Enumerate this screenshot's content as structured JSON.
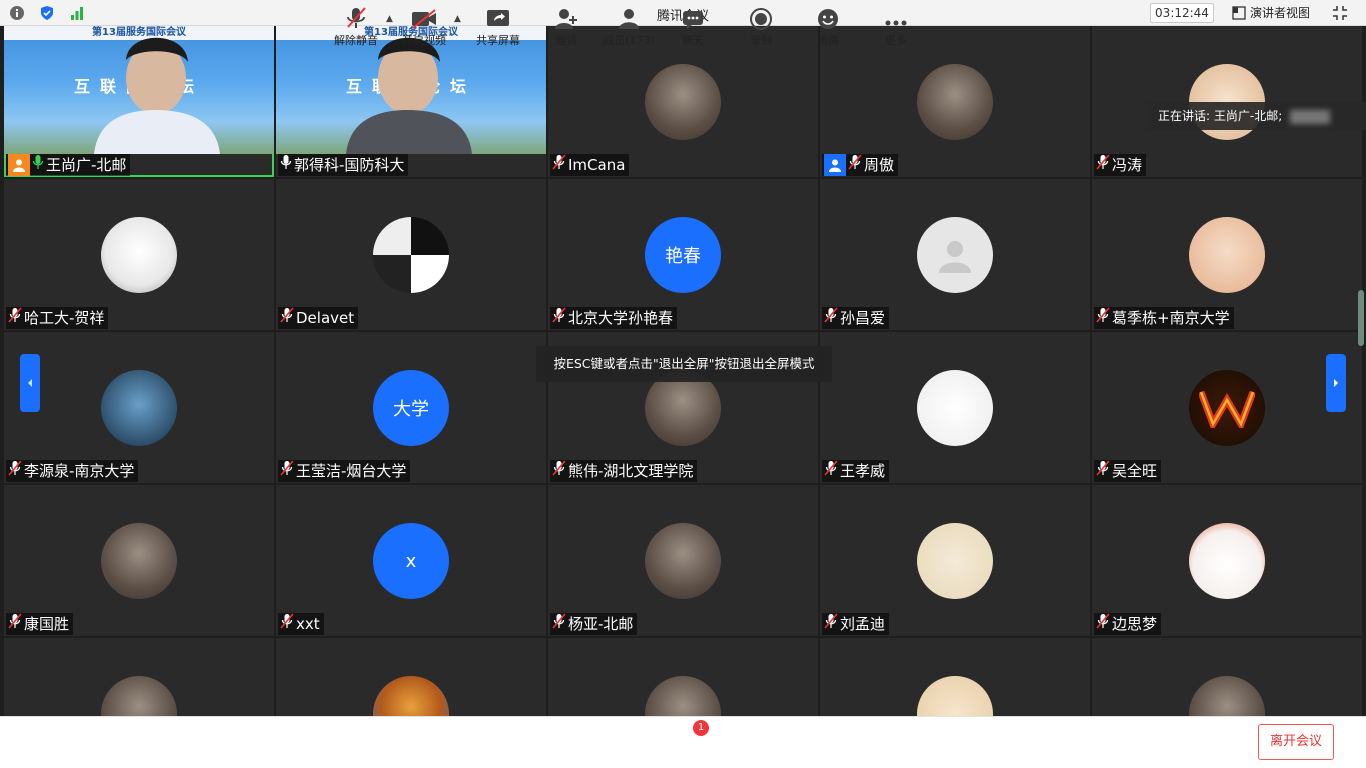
{
  "window": {
    "title": "腾讯会议",
    "timer": "03:12:44",
    "view_label": "演讲者视图"
  },
  "speaking": {
    "text": "正在讲话: 王尚广-北邮;"
  },
  "esc_tip": "按ESC键或者点击\"退出全屏\"按钮退出全屏模式",
  "video_banner": {
    "top": "第13届服务国际会议",
    "main": "互联网论坛"
  },
  "participants": [
    {
      "name": "王尚广-北邮",
      "mic": "on",
      "host": true,
      "video": true
    },
    {
      "name": "郭得科-国防科大",
      "mic": "on",
      "video": true
    },
    {
      "name": "ImCana",
      "mic": "muted",
      "avatar": "photo"
    },
    {
      "name": "周傲",
      "mic": "muted",
      "host": true,
      "avatar": "photo"
    },
    {
      "name": "冯涛",
      "mic": "muted",
      "avatar": "bear"
    },
    {
      "name": "哈工大-贺祥",
      "mic": "muted",
      "avatar": "anime"
    },
    {
      "name": "Delavet",
      "mic": "muted",
      "avatar": "crystal"
    },
    {
      "name": "北京大学孙艳春",
      "mic": "muted",
      "avatar_text": "艳春"
    },
    {
      "name": "孙昌爱",
      "mic": "muted",
      "avatar": "default"
    },
    {
      "name": "葛季栋+南京大学",
      "mic": "muted",
      "avatar": "baby"
    },
    {
      "name": "李源泉-南京大学",
      "mic": "muted",
      "avatar": "anime2"
    },
    {
      "name": "王莹洁-烟台大学",
      "mic": "muted",
      "avatar_text": "大学"
    },
    {
      "name": "熊伟-湖北文理学院",
      "mic": "muted",
      "avatar": "photo"
    },
    {
      "name": "王孝威",
      "mic": "muted",
      "avatar": "cat"
    },
    {
      "name": "吴全旺",
      "mic": "muted",
      "avatar": "w-logo"
    },
    {
      "name": "康国胜",
      "mic": "muted",
      "avatar": "photo"
    },
    {
      "name": "xxt",
      "mic": "muted",
      "avatar_text": "x"
    },
    {
      "name": "杨亚-北邮",
      "mic": "muted",
      "avatar": "photo"
    },
    {
      "name": "刘孟迪",
      "mic": "muted",
      "avatar": "cartoon"
    },
    {
      "name": "边思梦",
      "mic": "muted",
      "avatar": "cute"
    },
    {
      "name": "",
      "avatar": "photo"
    },
    {
      "name": "",
      "avatar": "tower"
    },
    {
      "name": "",
      "avatar": "photo"
    },
    {
      "name": "",
      "avatar": "corgi"
    },
    {
      "name": "",
      "avatar": "photo"
    }
  ],
  "toolbar": {
    "unmute": "解除静音",
    "video": "开启视频",
    "share": "共享屏幕",
    "invite": "邀请",
    "members": "成员(173)",
    "chat": "聊天",
    "chat_badge": "1",
    "record": "录制",
    "emoji": "表情",
    "more": "更多",
    "leave": "离开会议"
  },
  "colors": {
    "accent": "#1a6fff",
    "leave": "#e53935",
    "tile_bg": "#2a2a2a"
  }
}
